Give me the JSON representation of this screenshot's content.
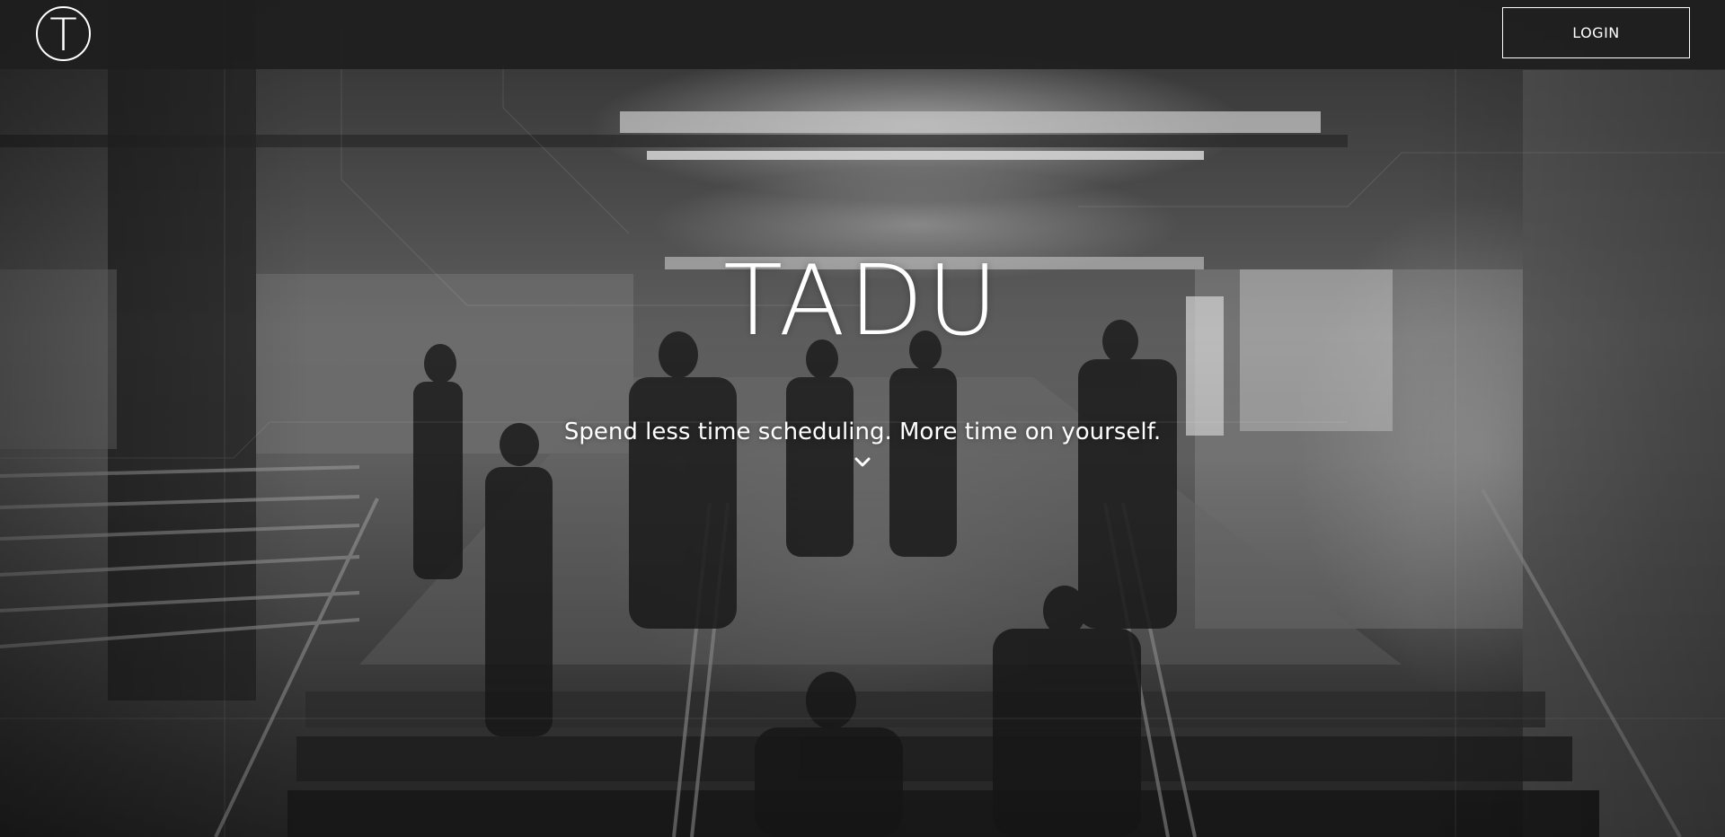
{
  "header": {
    "logo_letter": "T",
    "login_label": "LOGIN"
  },
  "hero": {
    "title": "TADU",
    "subtitle": "Spend less time scheduling. More time on yourself.",
    "background": "subway-station-photo",
    "scroll_icon": "chevron-down-icon"
  },
  "colors": {
    "header_bg": "#1e1e1e",
    "text": "#ffffff"
  }
}
